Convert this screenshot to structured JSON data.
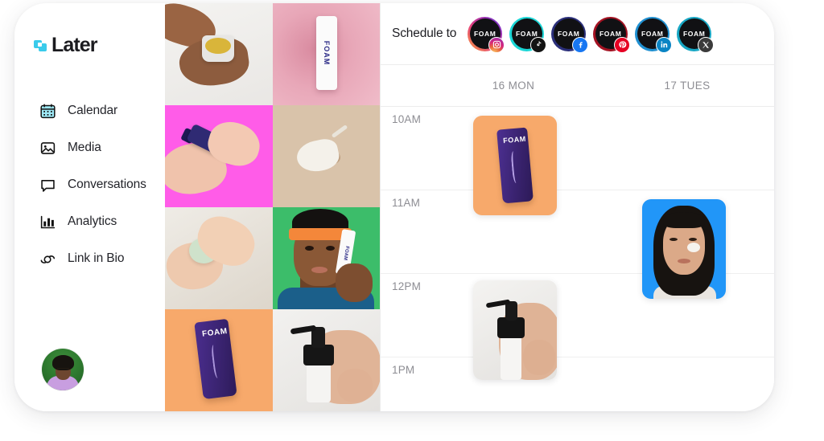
{
  "app": {
    "brand": "Later",
    "logo_color": "#3ACBEB"
  },
  "sidebar": {
    "items": [
      {
        "label": "Calendar",
        "icon": "calendar-icon",
        "active": true
      },
      {
        "label": "Media",
        "icon": "image-icon",
        "active": false
      },
      {
        "label": "Conversations",
        "icon": "chat-bubble-icon",
        "active": false
      },
      {
        "label": "Analytics",
        "icon": "bar-chart-icon",
        "active": false
      },
      {
        "label": "Link in Bio",
        "icon": "link-icon",
        "active": false
      }
    ],
    "profile_avatar_alt": "user-avatar"
  },
  "media_grid": {
    "tiles": [
      {
        "alt": "hands-holding-yellow-balm-jar"
      },
      {
        "alt": "white-foam-tube-on-pink",
        "product_label": "FOAM"
      },
      {
        "alt": "navy-bottle-in-hands-on-pink"
      },
      {
        "alt": "white-cream-swipe-on-beige"
      },
      {
        "alt": "hands-with-green-jar"
      },
      {
        "alt": "man-with-orange-headband-holding-foam-tube",
        "product_label": "FOAM"
      },
      {
        "alt": "purple-foam-tube-on-orange",
        "product_label": "FOAM"
      },
      {
        "alt": "hand-holding-black-pump-bottle"
      }
    ]
  },
  "calendar": {
    "schedule_label": "Schedule to",
    "accounts": [
      {
        "name": "FOAM",
        "platform": "instagram",
        "ring": "#d6257b",
        "badge_glyph": "◙"
      },
      {
        "name": "FOAM",
        "platform": "tiktok",
        "ring": "#1ad6d6",
        "badge_glyph": "♪"
      },
      {
        "name": "FOAM",
        "platform": "facebook",
        "ring": "#2b2f7a",
        "badge_glyph": "f"
      },
      {
        "name": "FOAM",
        "platform": "pinterest",
        "ring": "#a31222",
        "badge_glyph": "P"
      },
      {
        "name": "FOAM",
        "platform": "linkedin",
        "ring": "#1f8fd0",
        "badge_glyph": "in"
      },
      {
        "name": "FOAM",
        "platform": "x",
        "ring": "#17a7c4",
        "badge_glyph": "✕"
      }
    ],
    "days": [
      {
        "label": "16 MON"
      },
      {
        "label": "17 TUES"
      }
    ],
    "time_slots": [
      {
        "label": "10AM"
      },
      {
        "label": "11AM"
      },
      {
        "label": "12PM"
      },
      {
        "label": "1PM"
      }
    ],
    "posts": [
      {
        "alt": "purple-foam-tube-post",
        "day": "16 MON",
        "slot": "10AM",
        "product_label": "FOAM"
      },
      {
        "alt": "portrait-on-blue-post",
        "day": "17 TUES",
        "slot": "11AM"
      },
      {
        "alt": "hand-with-pump-bottle-post",
        "day": "16 MON",
        "slot": "12PM"
      }
    ]
  }
}
